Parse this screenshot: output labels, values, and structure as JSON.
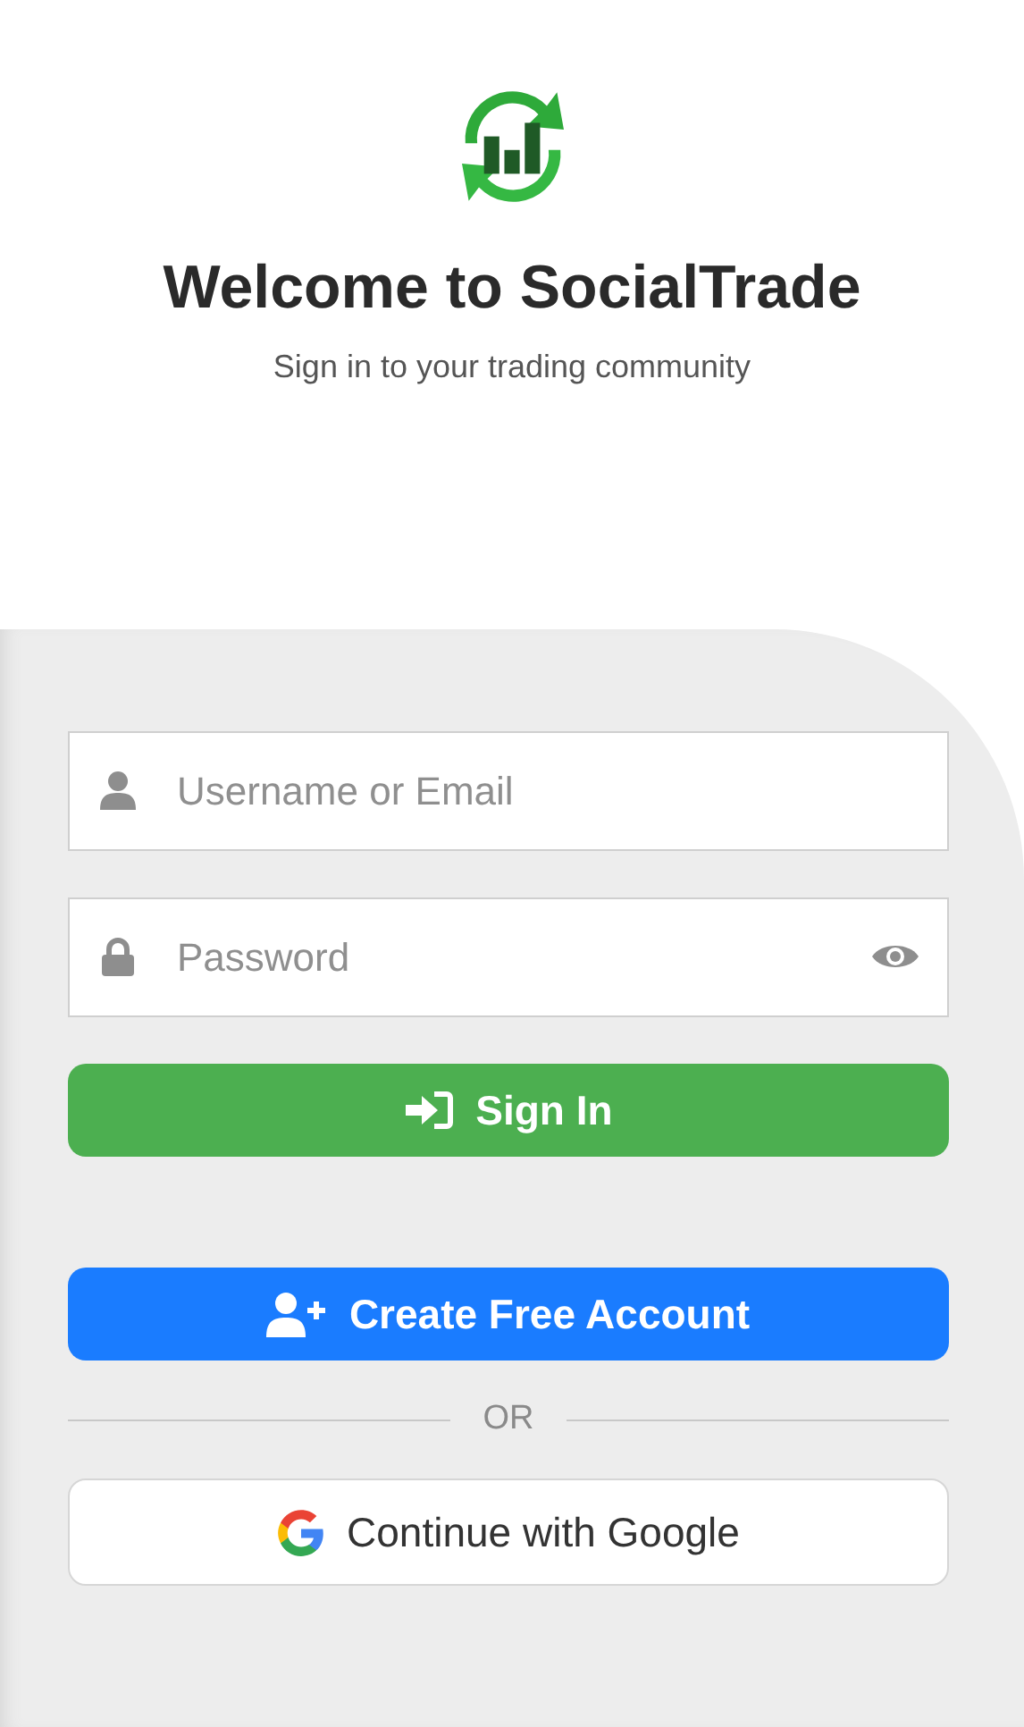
{
  "header": {
    "title": "Welcome to SocialTrade",
    "subtitle": "Sign in to your trading community"
  },
  "fields": [
    {
      "kind": "username",
      "placeholder": "Username or Email"
    },
    {
      "kind": "password",
      "placeholder": "Password"
    }
  ],
  "sign_in_button": "Sign In",
  "create_account_button": "Create Free Account",
  "divider": "OR",
  "google_button": "Continue with Google"
}
